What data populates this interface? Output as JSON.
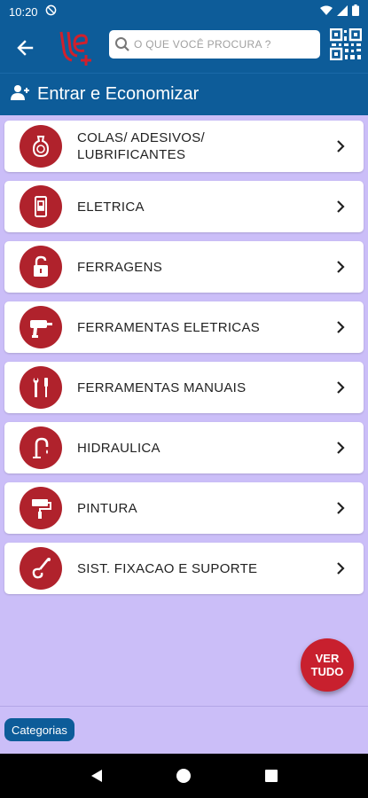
{
  "status": {
    "time": "10:20"
  },
  "search": {
    "placeholder": "O QUE VOCÊ PROCURA ?"
  },
  "login": {
    "label": "Entrar e Economizar"
  },
  "categories": [
    {
      "label": "COLAS/ ADESIVOS/ LUBRIFICANTES",
      "icon": "glue-bottle-icon"
    },
    {
      "label": "ELETRICA",
      "icon": "electric-switch-icon"
    },
    {
      "label": "FERRAGENS",
      "icon": "padlock-icon"
    },
    {
      "label": "FERRAMENTAS ELETRICAS",
      "icon": "power-drill-icon"
    },
    {
      "label": "FERRAMENTAS MANUAIS",
      "icon": "wrench-screwdriver-icon"
    },
    {
      "label": "HIDRAULICA",
      "icon": "faucet-icon"
    },
    {
      "label": "PINTURA",
      "icon": "paint-roller-icon"
    },
    {
      "label": "SIST. FIXACAO E SUPORTE",
      "icon": "hook-icon"
    }
  ],
  "fab": {
    "label": "VER\nTUDO"
  },
  "bottom": {
    "chip_label": "Categorias"
  },
  "colors": {
    "primary": "#0d5c99",
    "accent": "#b0222c",
    "background": "#cbbef8"
  }
}
